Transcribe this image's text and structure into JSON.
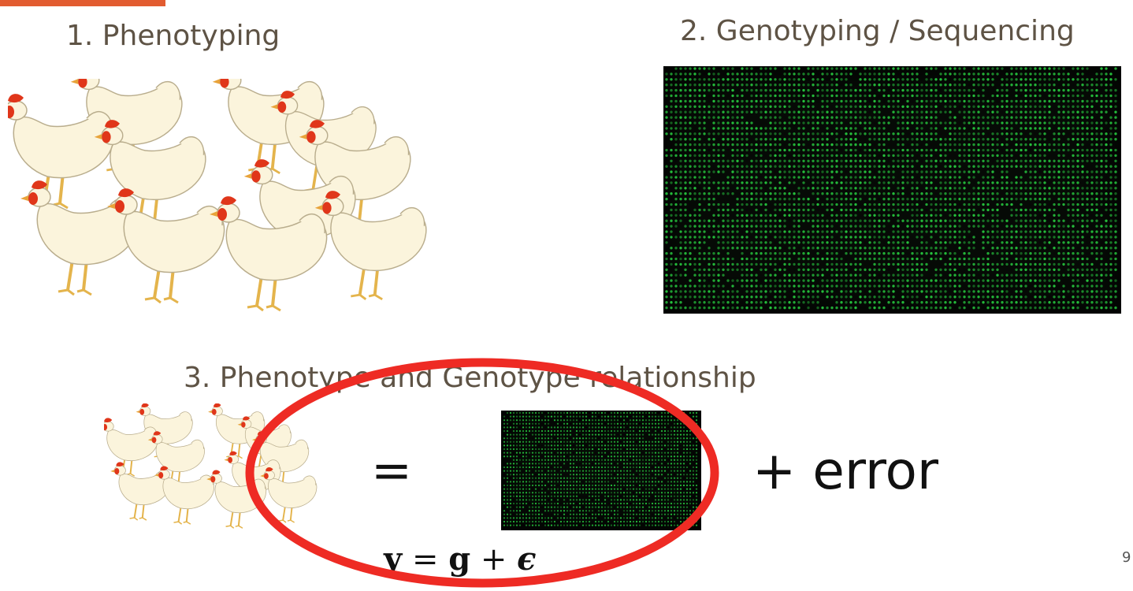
{
  "steps": {
    "phenotyping": "1. Phenotyping",
    "genotyping": "2. Genotyping / Sequencing",
    "relationship": "3. Phenotype and Genotype relationship"
  },
  "equation": {
    "equals": "=",
    "plus_error": "+  error",
    "formula_y": "y",
    "formula_eq": "=",
    "formula_g": "g",
    "formula_plus": "+",
    "formula_eps": "ϵ"
  },
  "page_number": "9",
  "icons": {
    "flock": "chicken-flock-icon",
    "matrix": "genotype-matrix-icon",
    "highlight": "red-ellipse-highlight"
  },
  "colors": {
    "title_text": "#5e5345",
    "accent_orange": "#e25c30",
    "highlight_red": "#ee2b24",
    "matrix_bg": "#060a06",
    "matrix_dots": "#27c93f",
    "chicken_body": "#fbf4dc",
    "chicken_comb": "#e0361a",
    "chicken_legs": "#e4b44c"
  }
}
